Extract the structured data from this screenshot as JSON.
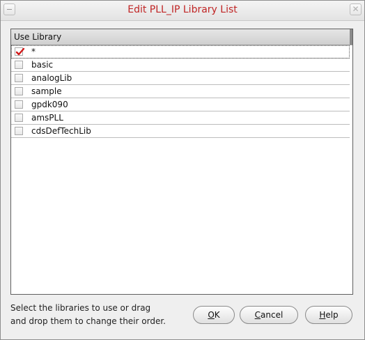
{
  "window": {
    "title": "Edit PLL_IP Library List",
    "close_glyph": "✕"
  },
  "list": {
    "header": "Use Library",
    "items": [
      {
        "label": "*",
        "checked": true
      },
      {
        "label": "basic",
        "checked": false
      },
      {
        "label": "analogLib",
        "checked": false
      },
      {
        "label": "sample",
        "checked": false
      },
      {
        "label": "gpdk090",
        "checked": false
      },
      {
        "label": "amsPLL",
        "checked": false
      },
      {
        "label": "cdsDefTechLib",
        "checked": false
      }
    ]
  },
  "status": {
    "line1": "Select the libraries to use or drag",
    "line2": "and drop them to change their order."
  },
  "buttons": {
    "ok": {
      "mnemonic": "O",
      "rest": "K"
    },
    "cancel": {
      "mnemonic": "C",
      "rest": "ancel"
    },
    "help": {
      "mnemonic": "H",
      "rest": "elp"
    }
  },
  "colors": {
    "title": "#c02525",
    "check": "#d11818"
  }
}
